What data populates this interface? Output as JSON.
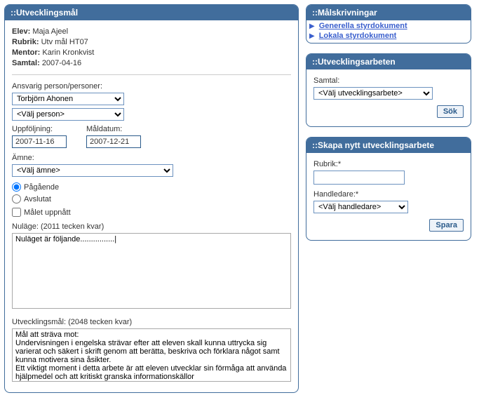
{
  "left": {
    "header": "::Utvecklingsmål",
    "elev_label": "Elev:",
    "elev_value": "Maja Ajeel",
    "rubrik_label": "Rubrik:",
    "rubrik_value": "Utv mål HT07",
    "mentor_label": "Mentor:",
    "mentor_value": "Karin Kronkvist",
    "samtal_label": "Samtal:",
    "samtal_value": "2007-04-16",
    "ansvarig_label": "Ansvarig person/personer:",
    "person1": "Torbjörn Ahonen",
    "person2": "<Välj person>",
    "uppfoljning_label": "Uppföljning:",
    "uppfoljning_value": "2007-11-16",
    "maldatum_label": "Måldatum:",
    "maldatum_value": "2007-12-21",
    "amne_label": "Ämne:",
    "amne_value": "<Välj ämne>",
    "pagaende": "Pågående",
    "avslutat": "Avslutat",
    "malet_uppnatt": "Målet uppnått",
    "nulage_label": "Nuläge: (2011 tecken kvar)",
    "nulage_text": "Nuläget är följande................|",
    "utvmal_label": "Utvecklingsmål: (2048 tecken kvar)",
    "utvmal_text": "Mål att sträva mot:\nUndervisningen i engelska strävar efter att eleven skall kunna uttrycka sig varierat och säkert i skrift genom att berätta, beskriva och förklara något samt kunna motivera sina åsikter.\nEtt viktigt moment i detta arbete är att eleven utvecklar sin förmåga att använda hjälpmedel och att kritiskt granska informationskällor"
  },
  "malskriv": {
    "header": "::Målskrivningar",
    "doc1": "Generella styrdokument",
    "doc2": "Lokala styrdokument"
  },
  "utvarb": {
    "header": "::Utvecklingsarbeten",
    "samtal_label": "Samtal:",
    "select_value": "<Välj utvecklingsarbete>",
    "sok": "Sök"
  },
  "skapa": {
    "header": "::Skapa nytt utvecklingsarbete",
    "rubrik_label": "Rubrik:*",
    "handledare_label": "Handledare:*",
    "handledare_value": "<Välj handledare>",
    "spara": "Spara"
  }
}
